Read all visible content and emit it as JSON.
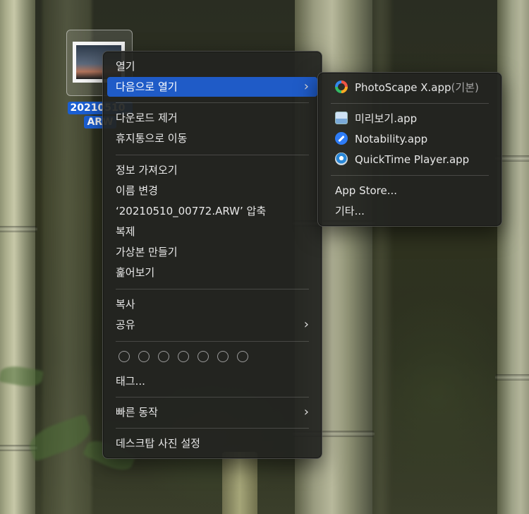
{
  "desktop_file": {
    "label_line1": "20210510_",
    "label_line2": "ARW"
  },
  "main_menu": {
    "open": "열기",
    "open_with": "다음으로 열기",
    "remove_download": "다운로드 제거",
    "move_to_trash": "휴지통으로 이동",
    "get_info": "정보 가져오기",
    "rename": "이름 변경",
    "compress": "‘20210510_00772.ARW’ 압축",
    "duplicate": "복제",
    "make_alias": "가상본 만들기",
    "quick_look": "훑어보기",
    "copy": "복사",
    "share": "공유",
    "tags": "태그...",
    "quick_actions": "빠른 동작",
    "set_desktop_picture": "데스크탑 사진 설정"
  },
  "open_with_menu": {
    "default_app": "PhotoScape X.app",
    "default_suffix": "(기본)",
    "apps": [
      "미리보기.app",
      "Notability.app",
      "QuickTime Player.app"
    ],
    "app_icons": [
      "preview-icon",
      "notability-icon",
      "quicktime-icon"
    ],
    "app_store": "App Store...",
    "other": "기타..."
  },
  "colors": {
    "highlight": "#1f5bc7",
    "selection_label": "#1b5fd3"
  }
}
